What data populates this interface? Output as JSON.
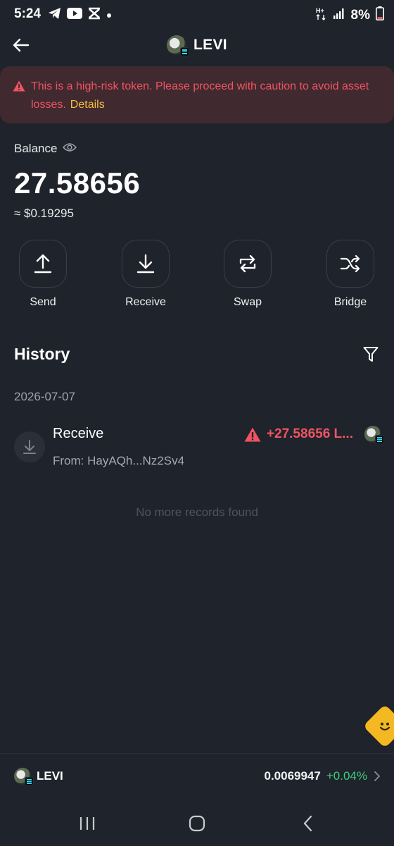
{
  "status_bar": {
    "time": "5:24",
    "battery": "8%",
    "left_icons": [
      "telegram-icon",
      "youtube-icon",
      "capcut-icon",
      "dot-icon"
    ],
    "right_icons": [
      "network-hplus-icon",
      "signal-icon",
      "battery-icon"
    ]
  },
  "header": {
    "title": "LEVI"
  },
  "warning": {
    "message": "This is a high-risk token. Please proceed with caution to avoid asset losses.",
    "details_label": "Details"
  },
  "balance": {
    "label": "Balance",
    "amount": "27.58656",
    "usd": "≈ $0.19295"
  },
  "actions": [
    {
      "label": "Send",
      "icon": "upload-icon"
    },
    {
      "label": "Receive",
      "icon": "download-icon"
    },
    {
      "label": "Swap",
      "icon": "swap-icon"
    },
    {
      "label": "Bridge",
      "icon": "shuffle-icon"
    }
  ],
  "history": {
    "title": "History",
    "date": "2026-07-07",
    "transactions": [
      {
        "type": "Receive",
        "from": "From: HayAQh...Nz2Sv4",
        "amount": "+27.58656 L..."
      }
    ],
    "empty_text": "No more records found"
  },
  "bottom_bar": {
    "token_name": "LEVI",
    "price": "0.0069947",
    "change": "+0.04%"
  },
  "colors": {
    "background": "#1f232b",
    "warning_bg": "#40292f",
    "danger": "#ef5463",
    "details": "#f2c03f",
    "positive": "#3ecf7a"
  }
}
